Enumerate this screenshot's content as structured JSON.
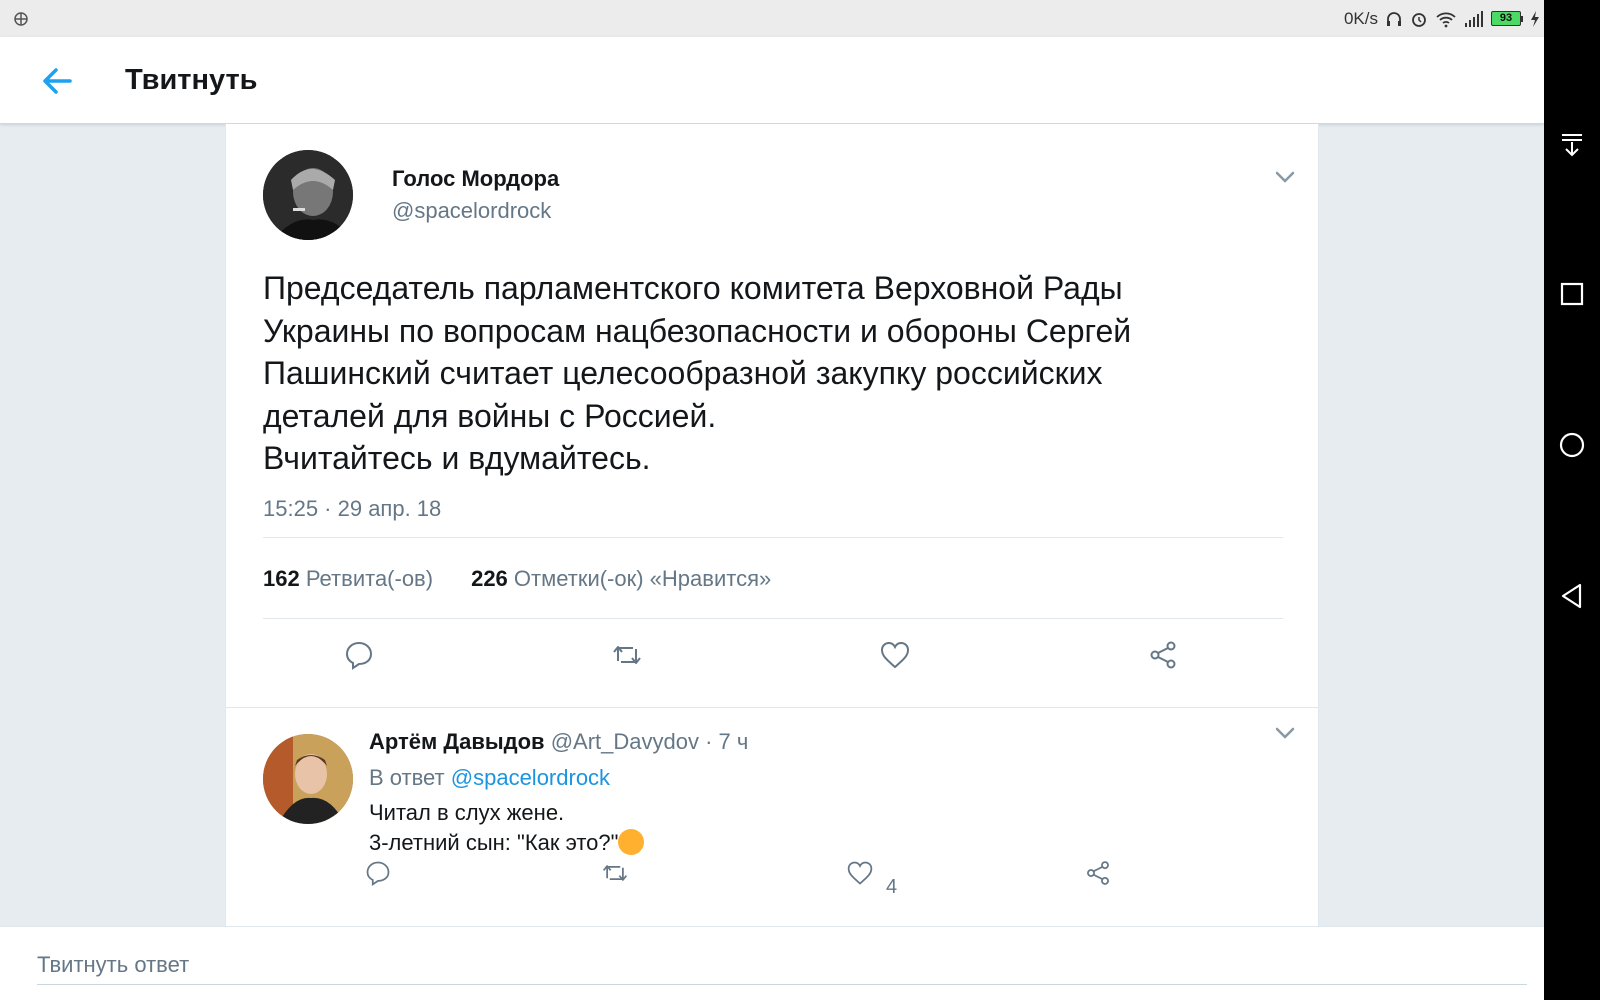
{
  "status_bar": {
    "speed": "0K/s",
    "battery": "93",
    "icons": [
      "sync-icon",
      "headphones-icon",
      "alarm-icon",
      "wifi-icon",
      "signal-icon",
      "battery-icon",
      "charging-icon"
    ]
  },
  "app_bar": {
    "title": "Твитнуть",
    "back_icon": "arrow-left-icon"
  },
  "tweet": {
    "author_name": "Голос Мордора",
    "author_handle": "@spacelordrock",
    "text_lines": [
      "Председатель парламентского комитета Верховной Рады",
      "Украины по вопросам нацбезопасности и обороны Сергей",
      "Пашинский считает целесообразной закупку российских",
      "деталей для войны с Россией.",
      "Вчитайтесь и вдумайтесь."
    ],
    "timestamp": "15:25 · 29 апр. 18",
    "retweets_count": "162",
    "retweets_label": "Ретвита(-ов)",
    "likes_count": "226",
    "likes_label": "Отметки(-ок) «Нравится»"
  },
  "reply": {
    "author_name": "Артём Давыдов",
    "meta": "@Art_Davydov · 7 ч",
    "reply_to_prefix": "В ответ",
    "reply_to_handle": "@spacelordrock",
    "line1": "Читал в слух жене.",
    "line2": "3-летний сын: \"Как это?\"",
    "emoji": "laughing-face-emoji",
    "like_count": "4"
  },
  "composer": {
    "placeholder": "Твитнуть ответ"
  },
  "colors": {
    "accent": "#1da1f2",
    "link": "#1b95e0",
    "secondary_text": "#657786",
    "background": "#e6ecf0"
  }
}
